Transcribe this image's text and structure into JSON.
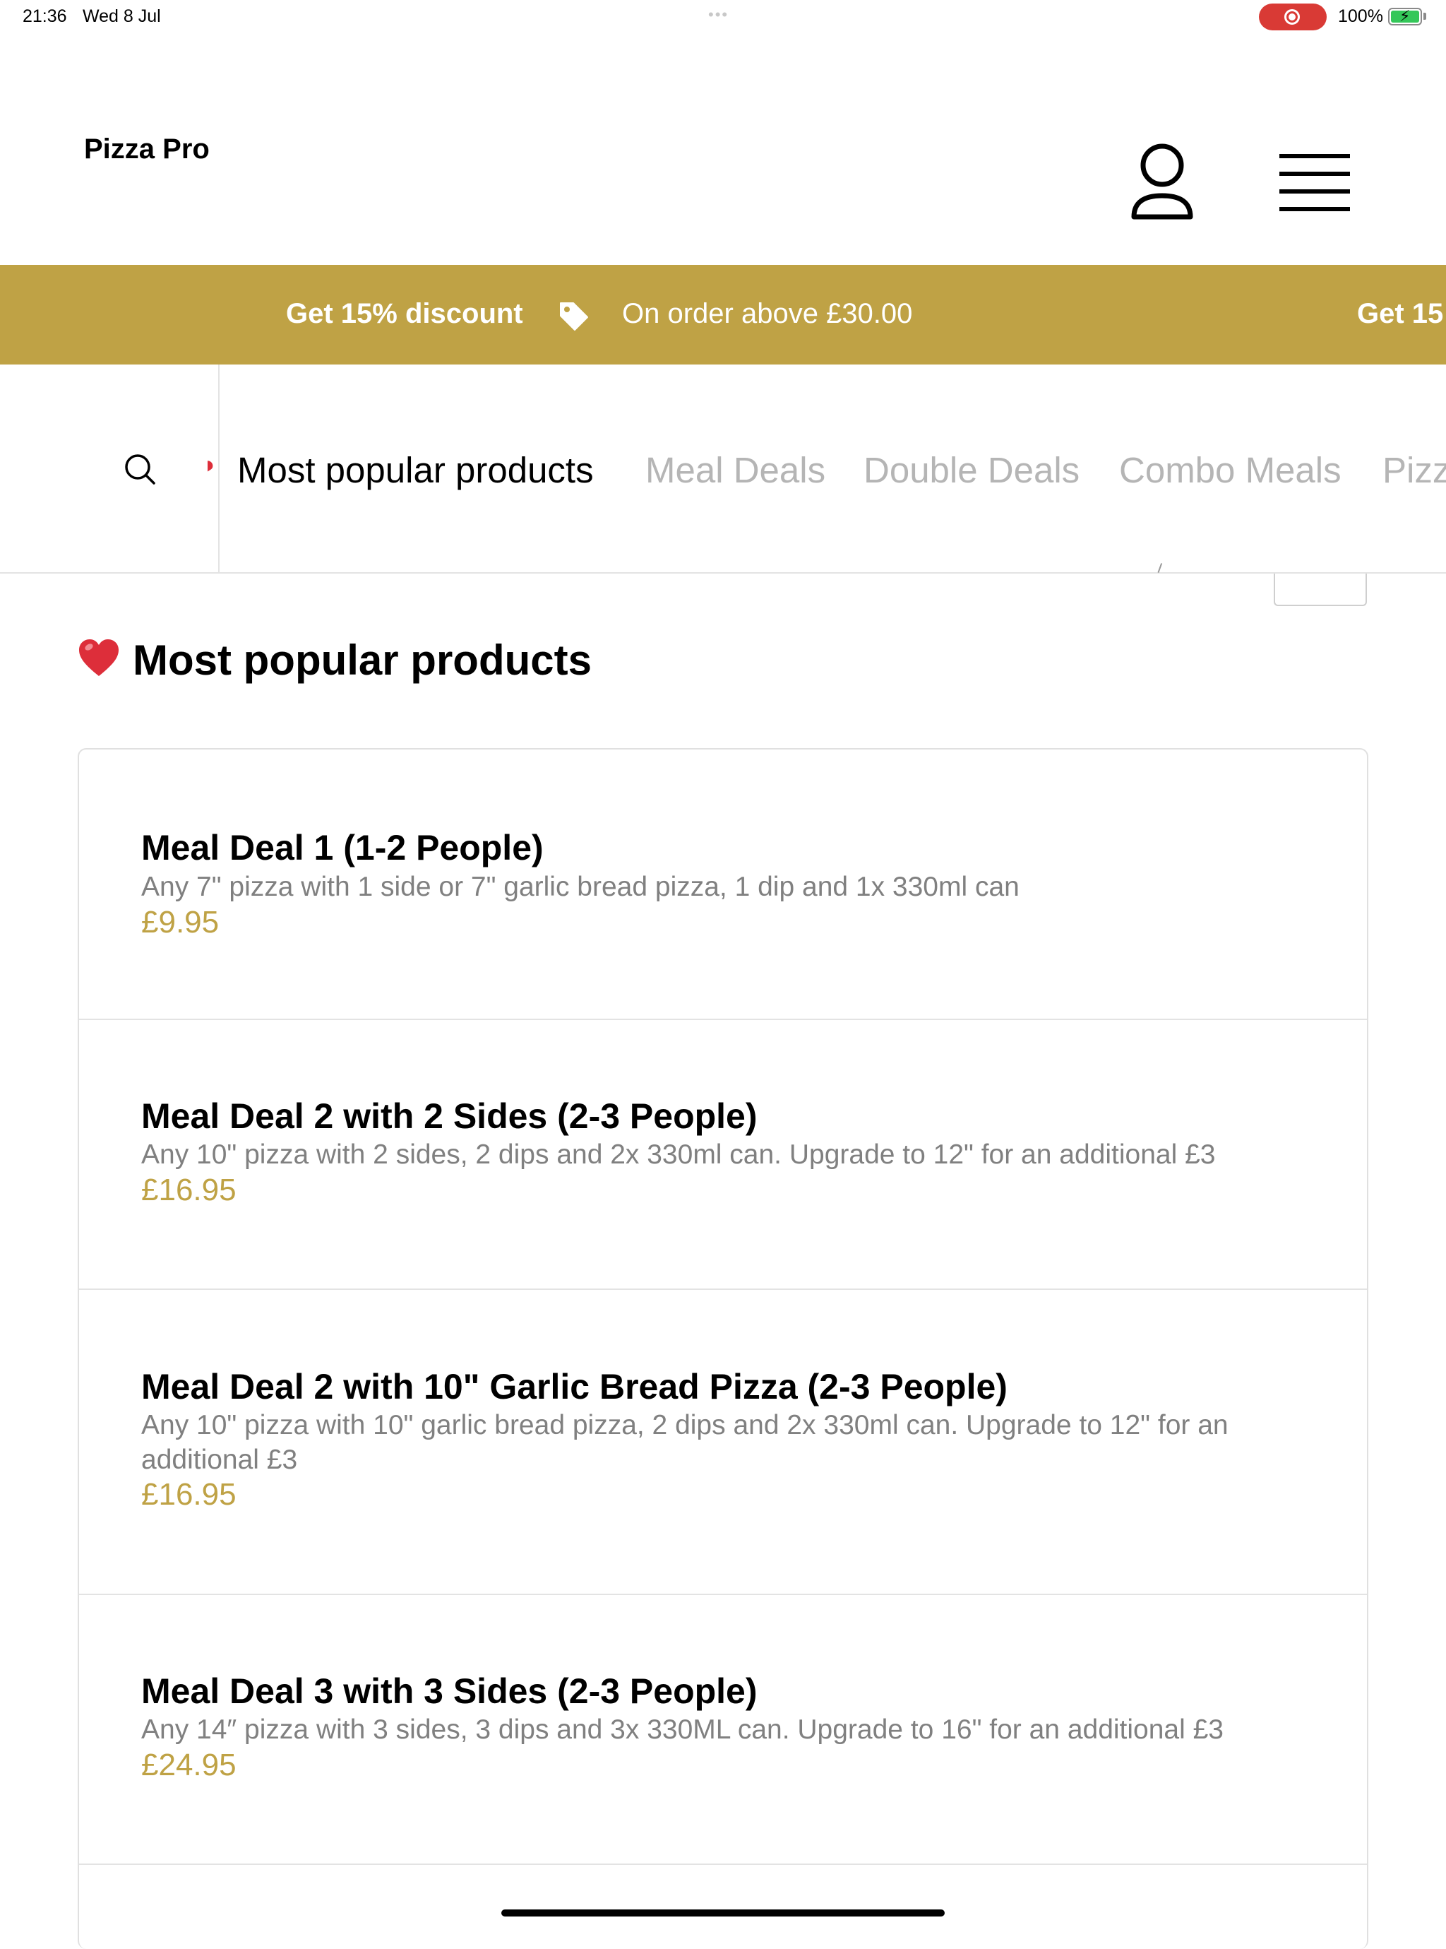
{
  "status_bar": {
    "time": "21:36",
    "date": "Wed 8 Jul",
    "battery": "100%"
  },
  "header": {
    "brand": "Pizza Pro",
    "icons": [
      "user-icon",
      "menu-icon"
    ]
  },
  "promo": {
    "headline": "Get 15% discount",
    "detail": "On order above £30.00",
    "headline_repeat": "Get 15",
    "icon": "tag-icon",
    "background": "#bfa245"
  },
  "category_nav": {
    "tabs": [
      {
        "label": "Most popular products",
        "active": true
      },
      {
        "label": "Meal Deals",
        "active": false
      },
      {
        "label": "Double Deals",
        "active": false
      },
      {
        "label": "Combo Meals",
        "active": false
      },
      {
        "label": "Pizz",
        "active": false
      }
    ]
  },
  "section": {
    "title": "Most popular products",
    "icon": "heart-icon"
  },
  "products": [
    {
      "name": "Meal Deal 1 (1-2 People)",
      "description": "Any 7\" pizza with 1 side or 7\" garlic bread pizza, 1 dip and 1x 330ml can",
      "price": "£9.95"
    },
    {
      "name": "Meal Deal 2 with 2 Sides (2-3 People)",
      "description": "Any 10\" pizza with 2 sides, 2 dips and 2x 330ml can. Upgrade to 12\" for an additional £3",
      "price": "£16.95"
    },
    {
      "name": "Meal Deal 2 with 10\" Garlic Bread Pizza (2-3 People)",
      "description": "Any 10\" pizza with 10\" garlic bread pizza, 2 dips and 2x 330ml can. Upgrade to 12\" for an additional £3",
      "price": "£16.95"
    },
    {
      "name": "Meal Deal 3 with 3 Sides (2-3 People)",
      "description": "Any 14″ pizza with 3 sides, 3 dips and 3x 330ML can. Upgrade to 16\" for an additional £3",
      "price": "£24.95"
    }
  ],
  "colors": {
    "accent": "#bfa245",
    "muted_text": "#808080",
    "inactive_tab": "#b5b5b5"
  }
}
